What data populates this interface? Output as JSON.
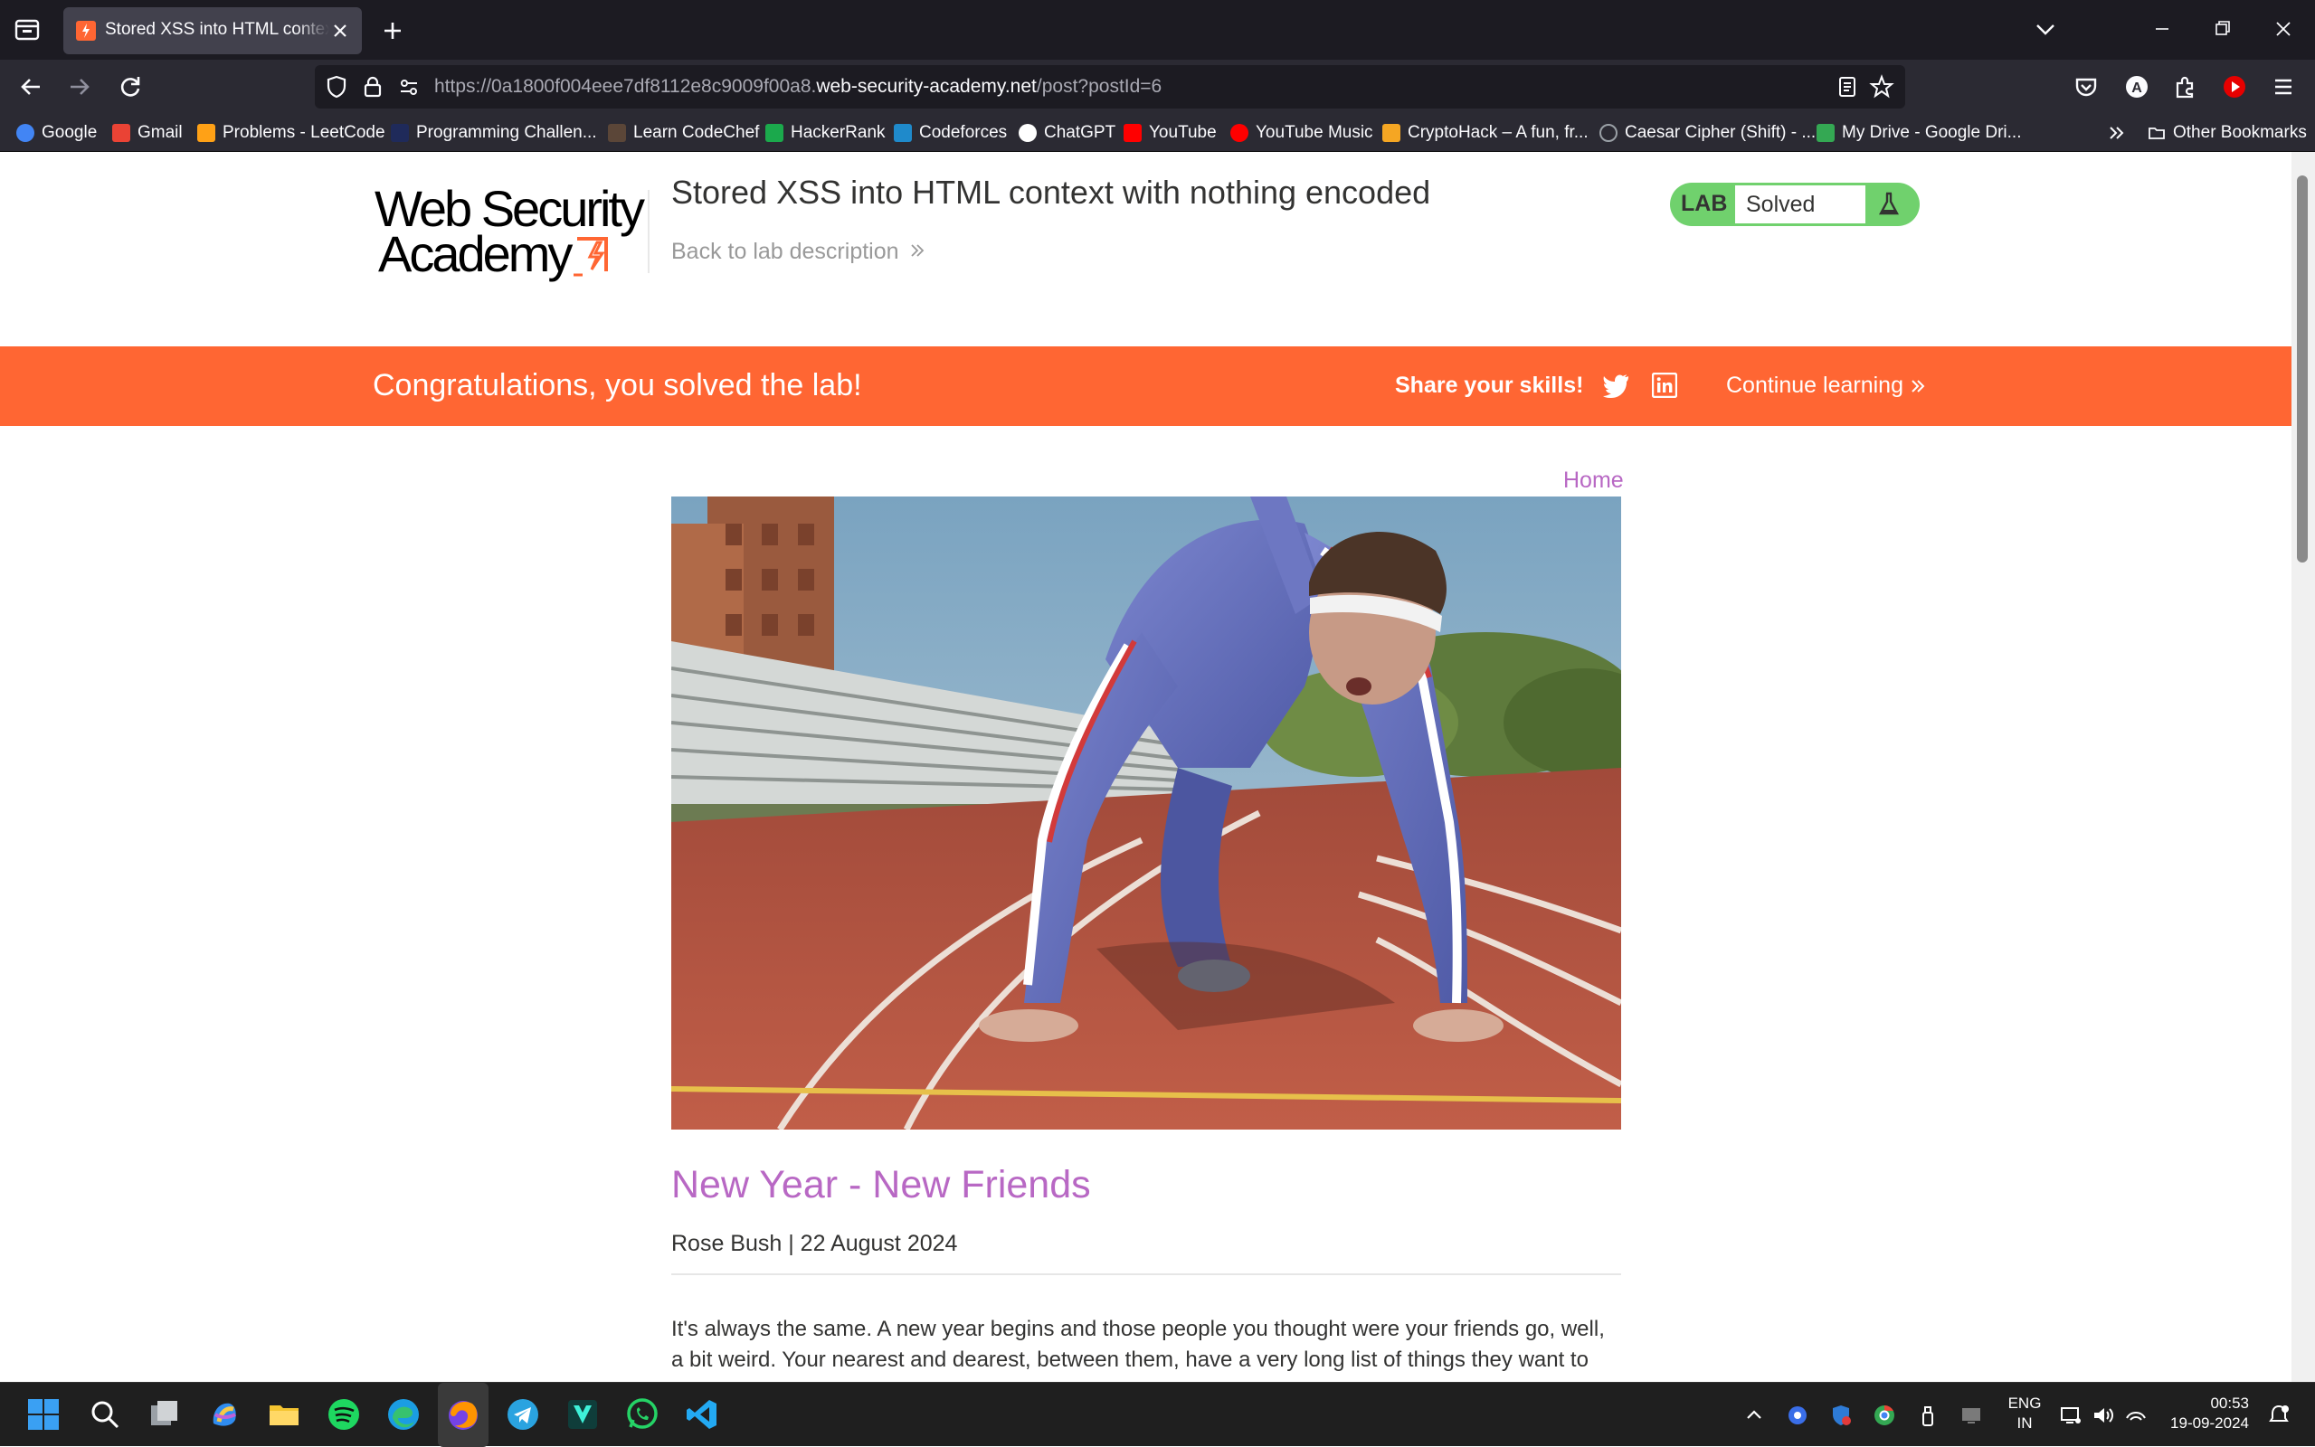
{
  "browser": {
    "tab_title": "Stored XSS into HTML context with nothing encoded",
    "url_prefix": "https://0a1800f004eee7df8112e8c9009f00a8.",
    "url_domain": "web-security-academy.net",
    "url_path": "/post?postId=6",
    "bookmarks": [
      {
        "label": "Google",
        "color": "#4285f4"
      },
      {
        "label": "Gmail",
        "color": "#ea4335"
      },
      {
        "label": "Problems - LeetCode",
        "color": "#ffa116"
      },
      {
        "label": "Programming Challen...",
        "color": "#1f2a5a"
      },
      {
        "label": "Learn CodeChef",
        "color": "#5b4638"
      },
      {
        "label": "HackerRank",
        "color": "#1ba94c"
      },
      {
        "label": "Codeforces",
        "color": "#1f8acb"
      },
      {
        "label": "ChatGPT",
        "color": "#ffffff"
      },
      {
        "label": "YouTube",
        "color": "#ff0000"
      },
      {
        "label": "YouTube Music",
        "color": "#ff0000"
      },
      {
        "label": "CryptoHack – A fun, fr...",
        "color": "#f5a623"
      },
      {
        "label": "Caesar Cipher (Shift) - ...",
        "color": "#9aa0a6"
      },
      {
        "label": "My Drive - Google Dri...",
        "color": "#34a853"
      }
    ],
    "other_bookmarks": "Other Bookmarks"
  },
  "header": {
    "logo_line1": "Web Security",
    "logo_line2": "Academy",
    "lab_title": "Stored XSS into HTML context with nothing encoded",
    "back_link": "Back to lab description",
    "lab_label": "LAB",
    "lab_status": "Solved"
  },
  "banner": {
    "congrats": "Congratulations, you solved the lab!",
    "share": "Share your skills!",
    "continue": "Continue learning"
  },
  "nav": {
    "home": "Home"
  },
  "post": {
    "title": "New Year - New Friends",
    "meta": "Rose Bush | 22 August 2024",
    "body": "It's always the same. A new year begins and those people you thought were your friends go, well, a bit weird. Your nearest and dearest, between them, have a very long list of things they want to"
  },
  "taskbar": {
    "lang_line1": "ENG",
    "lang_line2": "IN",
    "time": "00:53",
    "date": "19-09-2024"
  },
  "colors": {
    "accent_orange": "#ff6633",
    "link_purple": "#b868c4",
    "lab_green": "#70d16d"
  }
}
